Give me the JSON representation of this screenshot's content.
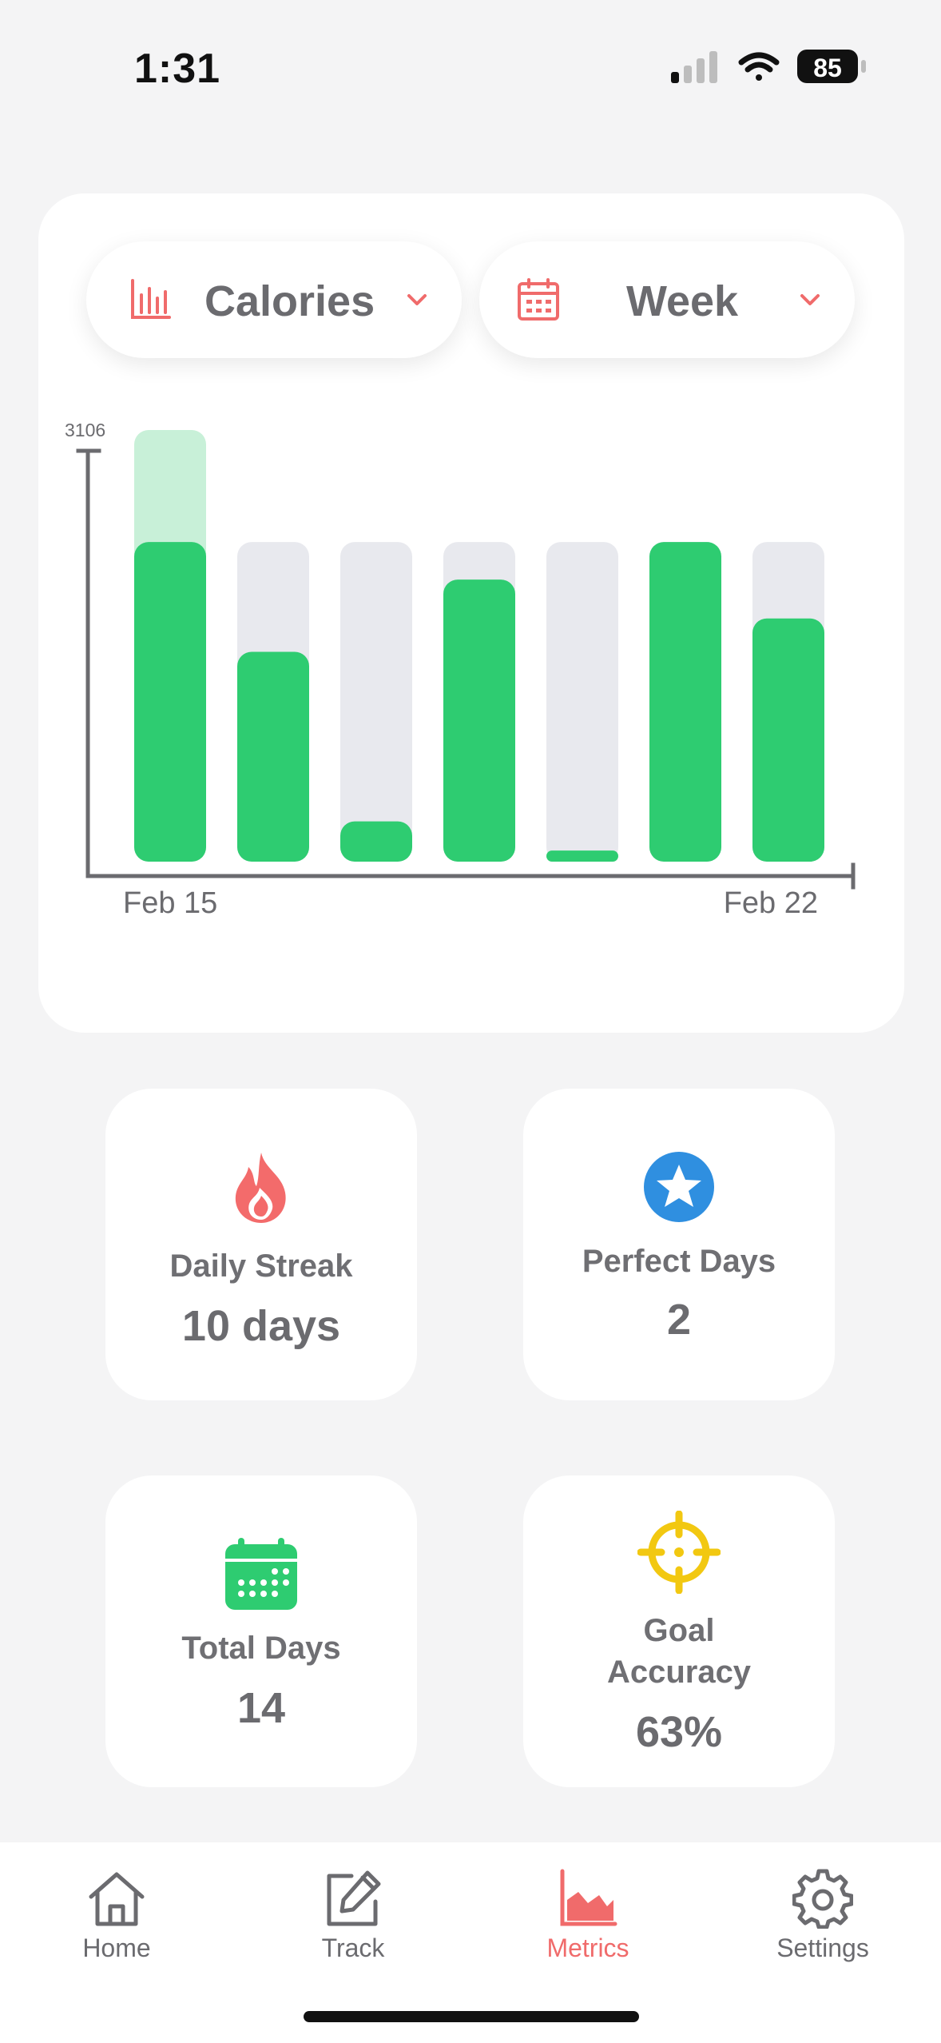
{
  "status_bar": {
    "time": "1:31",
    "battery": "85"
  },
  "selectors": {
    "metric": {
      "label": "Calories",
      "icon": "bar-chart-icon"
    },
    "range": {
      "label": "Week",
      "icon": "calendar-icon"
    }
  },
  "chart_data": {
    "type": "bar",
    "y_max_label": "3106",
    "ylim": [
      0,
      3106
    ],
    "x_start_label": "Feb 15",
    "x_end_label": "Feb 22",
    "goal": 2300,
    "values": [
      3106,
      1510,
      290,
      2030,
      80,
      2300,
      1750
    ],
    "colors": {
      "consumed": "#2ecc71",
      "over": "#c8f0d8",
      "remaining": "#e8e9ee"
    }
  },
  "stats": {
    "streak": {
      "label": "Daily Streak",
      "value": "10 days",
      "icon": "flame-icon"
    },
    "perfect": {
      "label": "Perfect Days",
      "value": "2",
      "icon": "star-badge-icon"
    },
    "total": {
      "label": "Total Days",
      "value": "14",
      "icon": "calendar-dots-icon"
    },
    "accuracy": {
      "label": "Goal Accuracy",
      "value": "63%",
      "icon": "crosshair-icon"
    }
  },
  "tabs": [
    {
      "label": "Home",
      "icon": "home-icon",
      "active": false
    },
    {
      "label": "Track",
      "icon": "edit-icon",
      "active": false
    },
    {
      "label": "Metrics",
      "icon": "area-chart-icon",
      "active": true
    },
    {
      "label": "Settings",
      "icon": "gear-icon",
      "active": false
    }
  ],
  "accent": "#f06b6b"
}
